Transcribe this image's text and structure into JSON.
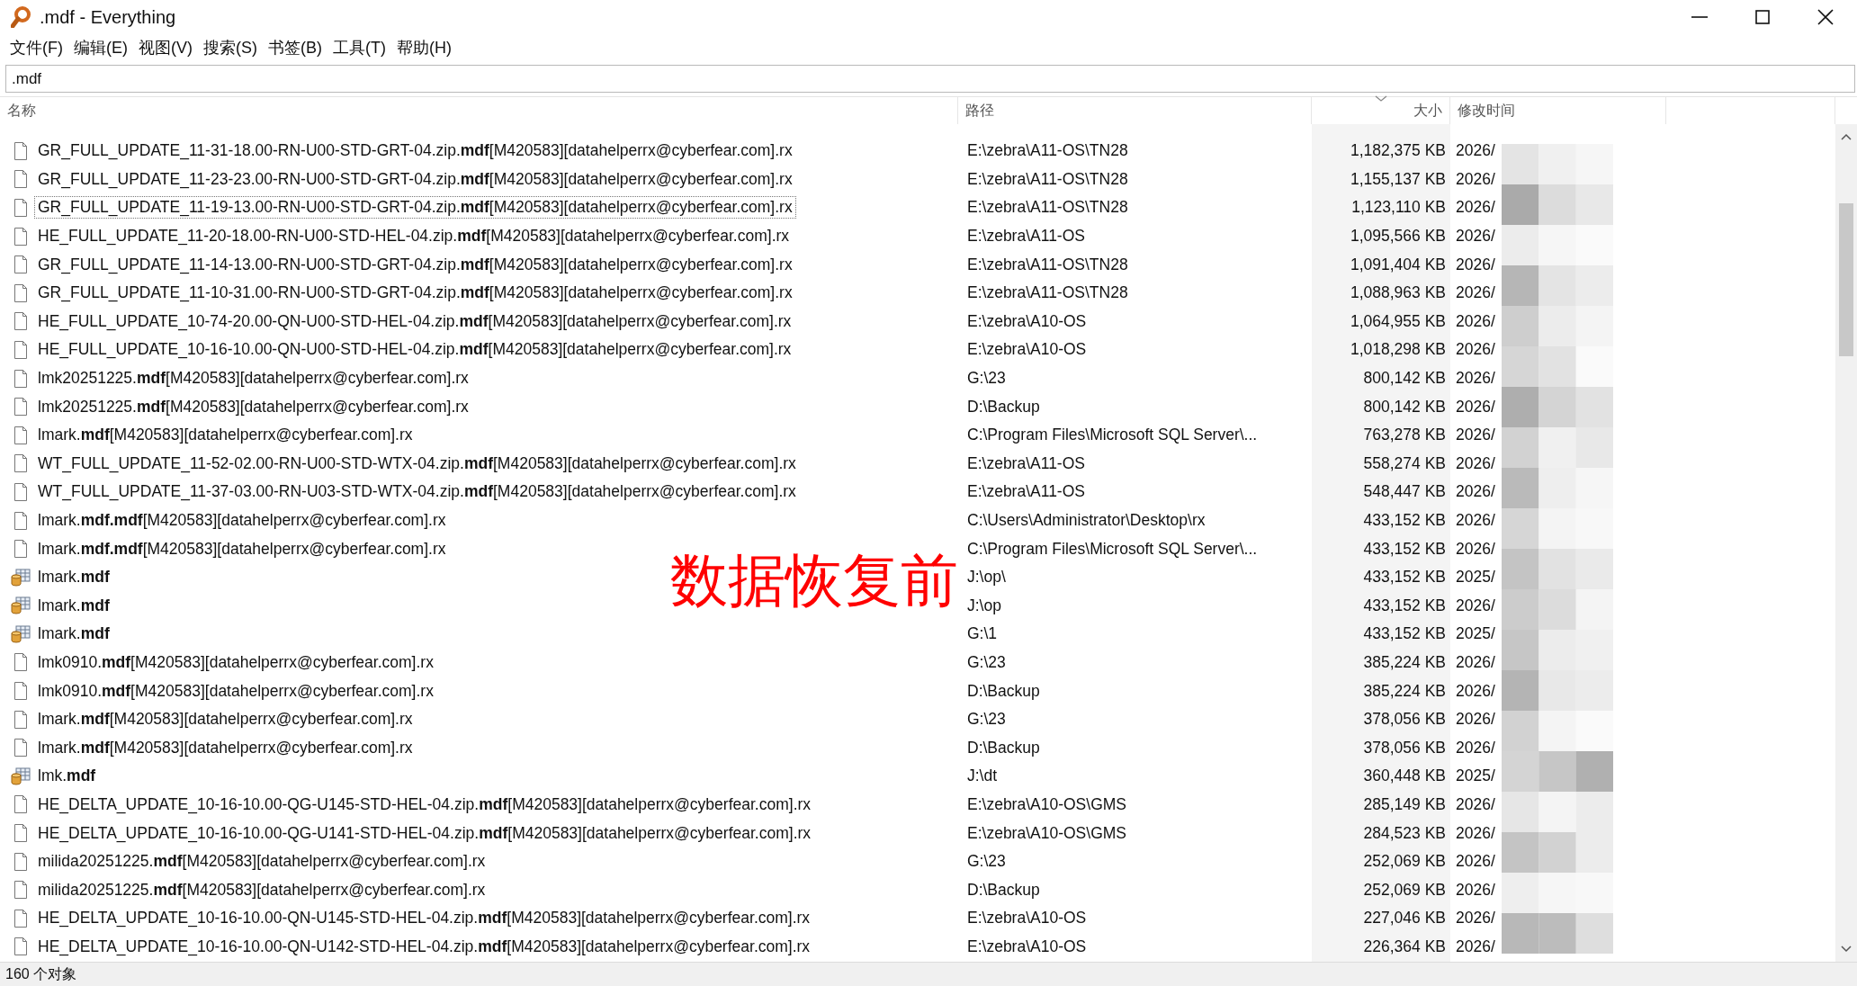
{
  "window": {
    "title": ".mdf - Everything"
  },
  "menu": [
    "文件(F)",
    "编辑(E)",
    "视图(V)",
    "搜索(S)",
    "书签(B)",
    "工具(T)",
    "帮助(H)"
  ],
  "search": {
    "value": ".mdf"
  },
  "columns": [
    "名称",
    "路径",
    "大小",
    "修改时间"
  ],
  "rows": [
    {
      "kind": "file",
      "name": "GR_FULL_UPDATE_11-31-18.00-RN-U00-STD-GRT-04.zip.**mdf**[M420583][datahelperrx@cyberfear.com].rx",
      "path": "E:\\zebra\\A11-OS\\TN28",
      "size": "1,182,375 KB",
      "date": "2026/",
      "focused": false
    },
    {
      "kind": "file",
      "name": "GR_FULL_UPDATE_11-23-23.00-RN-U00-STD-GRT-04.zip.**mdf**[M420583][datahelperrx@cyberfear.com].rx",
      "path": "E:\\zebra\\A11-OS\\TN28",
      "size": "1,155,137 KB",
      "date": "2026/",
      "focused": false
    },
    {
      "kind": "file",
      "name": "GR_FULL_UPDATE_11-19-13.00-RN-U00-STD-GRT-04.zip.**mdf**[M420583][datahelperrx@cyberfear.com].rx",
      "path": "E:\\zebra\\A11-OS\\TN28",
      "size": "1,123,110 KB",
      "date": "2026/",
      "focused": true
    },
    {
      "kind": "file",
      "name": "HE_FULL_UPDATE_11-20-18.00-RN-U00-STD-HEL-04.zip.**mdf**[M420583][datahelperrx@cyberfear.com].rx",
      "path": "E:\\zebra\\A11-OS",
      "size": "1,095,566 KB",
      "date": "2026/",
      "focused": false
    },
    {
      "kind": "file",
      "name": "GR_FULL_UPDATE_11-14-13.00-RN-U00-STD-GRT-04.zip.**mdf**[M420583][datahelperrx@cyberfear.com].rx",
      "path": "E:\\zebra\\A11-OS\\TN28",
      "size": "1,091,404 KB",
      "date": "2026/",
      "focused": false
    },
    {
      "kind": "file",
      "name": "GR_FULL_UPDATE_11-10-31.00-RN-U00-STD-GRT-04.zip.**mdf**[M420583][datahelperrx@cyberfear.com].rx",
      "path": "E:\\zebra\\A11-OS\\TN28",
      "size": "1,088,963 KB",
      "date": "2026/",
      "focused": false
    },
    {
      "kind": "file",
      "name": "HE_FULL_UPDATE_10-74-20.00-QN-U00-STD-HEL-04.zip.**mdf**[M420583][datahelperrx@cyberfear.com].rx",
      "path": "E:\\zebra\\A10-OS",
      "size": "1,064,955 KB",
      "date": "2026/",
      "focused": false
    },
    {
      "kind": "file",
      "name": "HE_FULL_UPDATE_10-16-10.00-QN-U00-STD-HEL-04.zip.**mdf**[M420583][datahelperrx@cyberfear.com].rx",
      "path": "E:\\zebra\\A10-OS",
      "size": "1,018,298 KB",
      "date": "2026/",
      "focused": false
    },
    {
      "kind": "file",
      "name": "lmk20251225.**mdf**[M420583][datahelperrx@cyberfear.com].rx",
      "path": "G:\\23",
      "size": "800,142 KB",
      "date": "2026/",
      "focused": false
    },
    {
      "kind": "file",
      "name": "lmk20251225.**mdf**[M420583][datahelperrx@cyberfear.com].rx",
      "path": "D:\\Backup",
      "size": "800,142 KB",
      "date": "2026/",
      "focused": false
    },
    {
      "kind": "file",
      "name": "lmark.**mdf**[M420583][datahelperrx@cyberfear.com].rx",
      "path": "C:\\Program Files\\Microsoft SQL Server\\...",
      "size": "763,278 KB",
      "date": "2026/",
      "focused": false
    },
    {
      "kind": "file",
      "name": "WT_FULL_UPDATE_11-52-02.00-RN-U00-STD-WTX-04.zip.**mdf**[M420583][datahelperrx@cyberfear.com].rx",
      "path": "E:\\zebra\\A11-OS",
      "size": "558,274 KB",
      "date": "2026/",
      "focused": false
    },
    {
      "kind": "file",
      "name": "WT_FULL_UPDATE_11-37-03.00-RN-U03-STD-WTX-04.zip.**mdf**[M420583][datahelperrx@cyberfear.com].rx",
      "path": "E:\\zebra\\A11-OS",
      "size": "548,447 KB",
      "date": "2026/",
      "focused": false
    },
    {
      "kind": "file",
      "name": "lmark.**mdf.mdf**[M420583][datahelperrx@cyberfear.com].rx",
      "path": "C:\\Users\\Administrator\\Desktop\\rx",
      "size": "433,152 KB",
      "date": "2026/",
      "focused": false
    },
    {
      "kind": "file",
      "name": "lmark.**mdf.mdf**[M420583][datahelperrx@cyberfear.com].rx",
      "path": "C:\\Program Files\\Microsoft SQL Server\\...",
      "size": "433,152 KB",
      "date": "2026/",
      "focused": false
    },
    {
      "kind": "database",
      "name": "lmark.**mdf**",
      "path": "J:\\op\\",
      "size": "433,152 KB",
      "date": "2025/",
      "focused": false
    },
    {
      "kind": "database",
      "name": "lmark.**mdf**",
      "path": "J:\\op",
      "size": "433,152 KB",
      "date": "2026/",
      "focused": false
    },
    {
      "kind": "database",
      "name": "lmark.**mdf**",
      "path": "G:\\1",
      "size": "433,152 KB",
      "date": "2025/",
      "focused": false
    },
    {
      "kind": "file",
      "name": "lmk0910.**mdf**[M420583][datahelperrx@cyberfear.com].rx",
      "path": "G:\\23",
      "size": "385,224 KB",
      "date": "2026/",
      "focused": false
    },
    {
      "kind": "file",
      "name": "lmk0910.**mdf**[M420583][datahelperrx@cyberfear.com].rx",
      "path": "D:\\Backup",
      "size": "385,224 KB",
      "date": "2026/",
      "focused": false
    },
    {
      "kind": "file",
      "name": "lmark.**mdf**[M420583][datahelperrx@cyberfear.com].rx",
      "path": "G:\\23",
      "size": "378,056 KB",
      "date": "2026/",
      "focused": false
    },
    {
      "kind": "file",
      "name": "lmark.**mdf**[M420583][datahelperrx@cyberfear.com].rx",
      "path": "D:\\Backup",
      "size": "378,056 KB",
      "date": "2026/",
      "focused": false
    },
    {
      "kind": "database",
      "name": "lmk.**mdf**",
      "path": "J:\\dt",
      "size": "360,448 KB",
      "date": "2025/",
      "focused": false
    },
    {
      "kind": "file",
      "name": "HE_DELTA_UPDATE_10-16-10.00-QG-U145-STD-HEL-04.zip.**mdf**[M420583][datahelperrx@cyberfear.com].rx",
      "path": "E:\\zebra\\A10-OS\\GMS",
      "size": "285,149 KB",
      "date": "2026/",
      "focused": false
    },
    {
      "kind": "file",
      "name": "HE_DELTA_UPDATE_10-16-10.00-QG-U141-STD-HEL-04.zip.**mdf**[M420583][datahelperrx@cyberfear.com].rx",
      "path": "E:\\zebra\\A10-OS\\GMS",
      "size": "284,523 KB",
      "date": "2026/",
      "focused": false
    },
    {
      "kind": "file",
      "name": "milida20251225.**mdf**[M420583][datahelperrx@cyberfear.com].rx",
      "path": "G:\\23",
      "size": "252,069 KB",
      "date": "2026/",
      "focused": false
    },
    {
      "kind": "file",
      "name": "milida20251225.**mdf**[M420583][datahelperrx@cyberfear.com].rx",
      "path": "D:\\Backup",
      "size": "252,069 KB",
      "date": "2026/",
      "focused": false
    },
    {
      "kind": "file",
      "name": "HE_DELTA_UPDATE_10-16-10.00-QN-U145-STD-HEL-04.zip.**mdf**[M420583][datahelperrx@cyberfear.com].rx",
      "path": "E:\\zebra\\A10-OS",
      "size": "227,046 KB",
      "date": "2026/",
      "focused": false
    },
    {
      "kind": "file",
      "name": "HE_DELTA_UPDATE_10-16-10.00-QN-U142-STD-HEL-04.zip.**mdf**[M420583][datahelperrx@cyberfear.com].rx",
      "path": "E:\\zebra\\A10-OS",
      "size": "226,364 KB",
      "date": "2026/",
      "focused": false
    }
  ],
  "status_bar": "160 个对象",
  "annotation": "数据恢复前"
}
